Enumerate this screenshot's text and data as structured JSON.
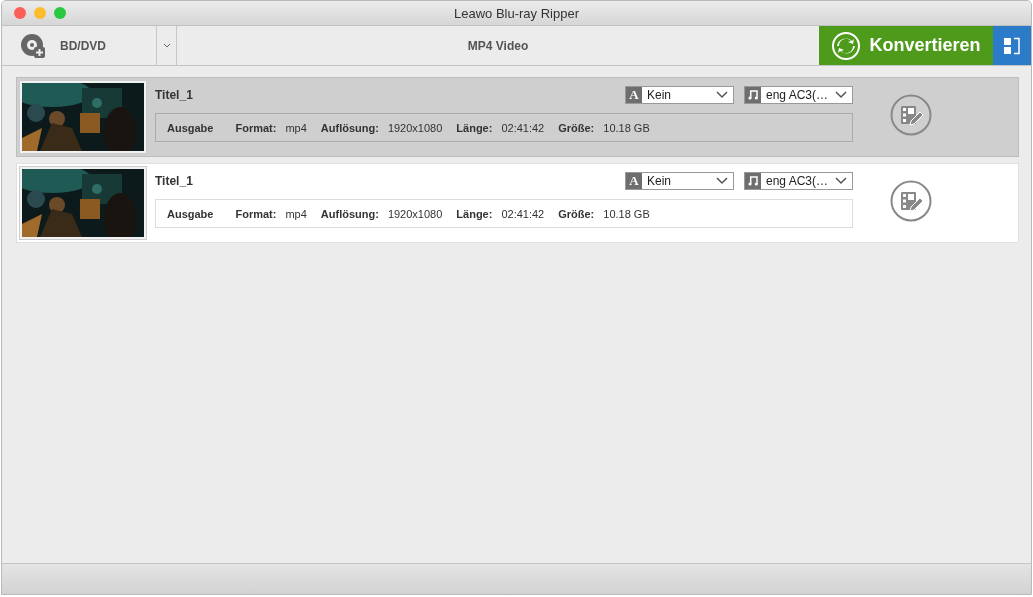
{
  "window": {
    "title": "Leawo Blu-ray Ripper"
  },
  "toolbar": {
    "source": "BD/DVD",
    "profile": "MP4 Video",
    "convert": "Konvertieren"
  },
  "titles": [
    {
      "name": "Titel_1",
      "selected": true,
      "subtitle_glyph": "A",
      "subtitle": "Kein",
      "audio": "eng AC3(…",
      "output": "Ausgabe",
      "fields": [
        {
          "label": "Format:",
          "value": "mp4"
        },
        {
          "label": "Auflösung:",
          "value": "1920x1080"
        },
        {
          "label": "Länge:",
          "value": "02:41:42"
        },
        {
          "label": "Größe:",
          "value": "10.18 GB"
        }
      ]
    },
    {
      "name": "Titel_1",
      "selected": false,
      "subtitle_glyph": "A",
      "subtitle": "Kein",
      "audio": "eng AC3(…",
      "output": "Ausgabe",
      "fields": [
        {
          "label": "Format:",
          "value": "mp4"
        },
        {
          "label": "Auflösung:",
          "value": "1920x1080"
        },
        {
          "label": "Länge:",
          "value": "02:41:42"
        },
        {
          "label": "Größe:",
          "value": "10.18 GB"
        }
      ]
    }
  ]
}
